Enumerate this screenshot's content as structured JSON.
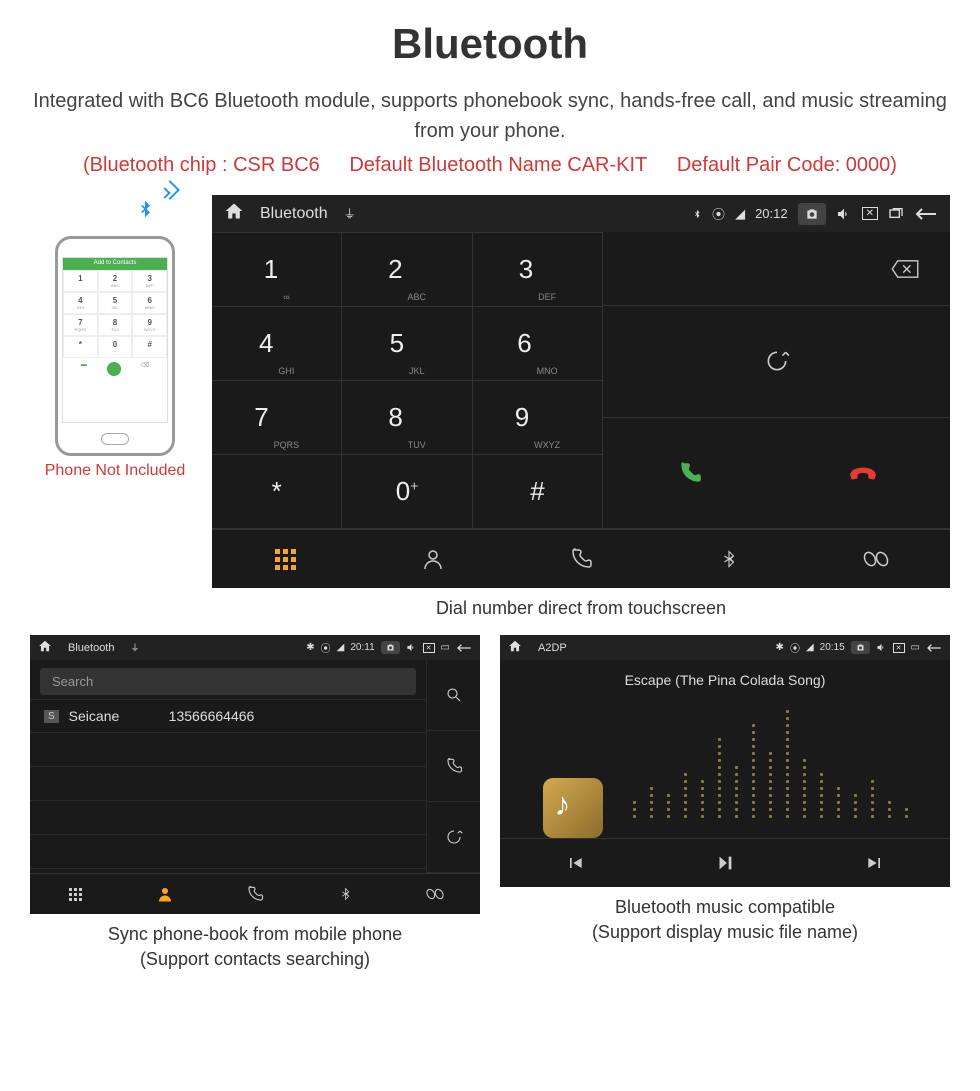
{
  "title": "Bluetooth",
  "description": "Integrated with BC6 Bluetooth module, supports phonebook sync, hands-free call, and music streaming from your phone.",
  "specs": {
    "chip": "(Bluetooth chip : CSR BC6",
    "name": "Default Bluetooth Name CAR-KIT",
    "code": "Default Pair Code: 0000)"
  },
  "phone": {
    "bar": "Add to Contacts",
    "caption": "Phone Not Included",
    "keys": [
      {
        "n": "1",
        "s": ""
      },
      {
        "n": "2",
        "s": "ABC"
      },
      {
        "n": "3",
        "s": "DEF"
      },
      {
        "n": "4",
        "s": "GHI"
      },
      {
        "n": "5",
        "s": "JKL"
      },
      {
        "n": "6",
        "s": "MNO"
      },
      {
        "n": "7",
        "s": "PQRS"
      },
      {
        "n": "8",
        "s": "TUV"
      },
      {
        "n": "9",
        "s": "WXYZ"
      },
      {
        "n": "*",
        "s": ""
      },
      {
        "n": "0",
        "s": "+"
      },
      {
        "n": "#",
        "s": ""
      }
    ]
  },
  "dialer": {
    "topbar_title": "Bluetooth",
    "time": "20:12",
    "keys": [
      {
        "n": "1",
        "s": "∞"
      },
      {
        "n": "2",
        "s": "ABC"
      },
      {
        "n": "3",
        "s": "DEF"
      },
      {
        "n": "4",
        "s": "GHI"
      },
      {
        "n": "5",
        "s": "JKL"
      },
      {
        "n": "6",
        "s": "MNO"
      },
      {
        "n": "7",
        "s": "PQRS"
      },
      {
        "n": "8",
        "s": "TUV"
      },
      {
        "n": "9",
        "s": "WXYZ"
      },
      {
        "n": "*",
        "s": ""
      },
      {
        "n": "0",
        "s": "+",
        "sup": true
      },
      {
        "n": "#",
        "s": ""
      }
    ],
    "caption": "Dial number direct from touchscreen"
  },
  "phonebook": {
    "topbar_title": "Bluetooth",
    "time": "20:11",
    "search": "Search",
    "contact_badge": "S",
    "contact_name": "Seicane",
    "contact_phone": "13566664466",
    "caption1": "Sync phone-book from mobile phone",
    "caption2": "(Support contacts searching)"
  },
  "music": {
    "topbar_title": "A2DP",
    "time": "20:15",
    "song": "Escape (The Pina Colada Song)",
    "caption1": "Bluetooth music compatible",
    "caption2": "(Support display music file name)",
    "viz_heights": [
      3,
      5,
      4,
      7,
      6,
      12,
      8,
      14,
      10,
      16,
      9,
      7,
      5,
      4,
      6,
      3,
      2
    ]
  }
}
